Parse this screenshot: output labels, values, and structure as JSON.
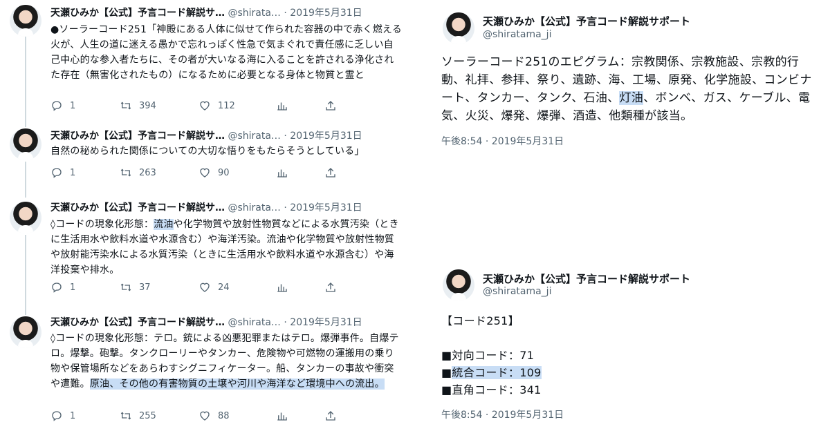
{
  "author": {
    "name": "天瀬ひみか【公式】予言コード解説サ…",
    "full_name": "天瀬ひみか【公式】予言コード解説サポート",
    "handle_short": "@shirata…",
    "handle": "@shiratama_ji"
  },
  "thread": [
    {
      "time": "2019年5月31日",
      "body": "●ソーラーコード251「神殿にある人体に似せて作られた容器の中で赤く燃える火が、人生の道に迷える愚かで忘れっぽく性急で気まぐれで責任感に乏しい自己中心的な参入者たちに、その者が大いなる海に入ることを許される浄化された存在（無害化されたもの）になるために必要となる身体と物質と霊と",
      "replies": "1",
      "retweets": "394",
      "likes": "112"
    },
    {
      "time": "2019年5月31日",
      "body": "自然の秘められた関係についての大切な悟りをもたらそうとしている」",
      "replies": "1",
      "retweets": "263",
      "likes": "90"
    },
    {
      "time": "2019年5月31日",
      "body_before": "◊コードの現象化形態：",
      "body_highlight": "流油",
      "body_after": "や化学物質や放射性物質などによる水質汚染（ときに生活用水や飲料水道や水源含む）や海洋汚染。流油や化学物質や放射性物質や放射能汚染水による水質汚染（ときに生活用水や飲料水道や水源含む）や海洋投棄や排水。",
      "replies": "1",
      "retweets": "37",
      "likes": "24"
    },
    {
      "time": "2019年5月31日",
      "body_before": "◊コードの現象化形態：テロ。銃による凶悪犯罪またはテロ。爆弾事件。自爆テロ。爆撃。砲撃。タンクローリーやタンカー、危険物や可燃物の運搬用の乗り物や保管場所などをあらわすシグニフィケーター。船、タンカーの事故や衝突や遭難。",
      "body_highlight": "原油、その他の有害物質の土壌や河川や海洋など環境中への流出。",
      "replies": "1",
      "retweets": "255",
      "likes": "88"
    }
  ],
  "detail_top": {
    "body_before": "ソーラーコード251のエピグラム：宗教関係、宗教施設、宗教的行動、礼拝、参拝、祭り、遺跡、海、工場、原発、化学施設、コンビナート、タンカー、タンク、石油、",
    "body_highlight": "灯油",
    "body_after": "、ボンベ、ガス、ケーブル、電気、火災、爆発、爆弾、酒造、他類種が該当。",
    "timestamp": "午後8:54 · 2019年5月31日"
  },
  "detail_bottom": {
    "title": "【コード251】",
    "line1": "■対向コード：71",
    "line2_bullet": "■",
    "line2_highlight": "統合コード：109",
    "line3": "■直角コード：341",
    "timestamp": "午後8:54 · 2019年5月31日"
  },
  "ui": {
    "dot": " · ",
    "highlight_color": "#c8ddf5"
  }
}
